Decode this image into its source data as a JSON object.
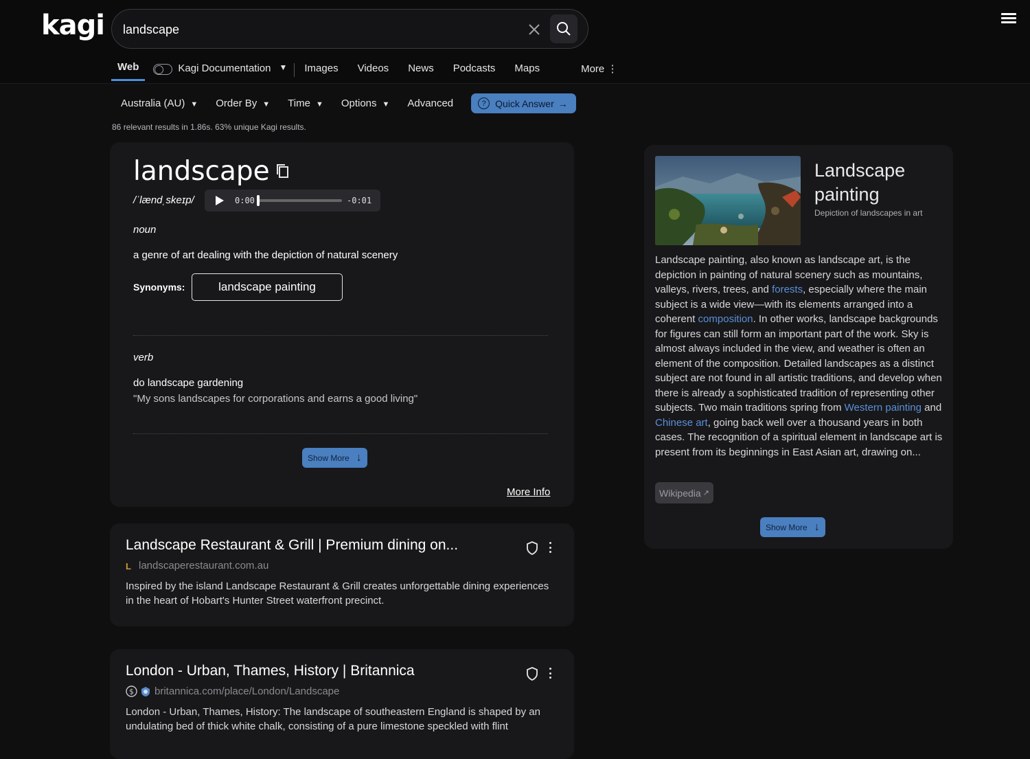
{
  "header": {
    "logo": "kagi",
    "search": {
      "value": "landscape",
      "placeholder": ""
    },
    "tabs": {
      "web": "Web",
      "lens": "Kagi Documentation",
      "images": "Images",
      "videos": "Videos",
      "news": "News",
      "podcasts": "Podcasts",
      "maps": "Maps",
      "more": "More"
    }
  },
  "filters": {
    "region": "Australia (AU)",
    "order_by": "Order By",
    "time": "Time",
    "options": "Options",
    "advanced": "Advanced",
    "quick_answer": "Quick Answer"
  },
  "stats": {
    "count": "86",
    "count_suffix": " relevant results in ",
    "time": "1.86s",
    "sep": ". ",
    "unique": "63%",
    "unique_suffix": " unique Kagi results."
  },
  "dictionary": {
    "word": "landscape",
    "phonetic": "/ˈlændˌskeɪp/",
    "audio": {
      "current": "0:00",
      "remaining": "-0:01",
      "progress": 0
    },
    "noun": {
      "pos": "noun",
      "definition": "a genre of art dealing with the depiction of natural scenery",
      "synonyms_label": "Synonyms:",
      "synonym": "landscape painting"
    },
    "verb": {
      "pos": "verb",
      "definition": "do landscape gardening",
      "example": "\"My sons landscapes for corporations and earns a good living\""
    },
    "show_more": "Show More",
    "more_info": "More Info"
  },
  "results": [
    {
      "title": "Landscape Restaurant & Grill | Premium dining on...",
      "favicon": "L",
      "url": "landscaperestaurant.com.au",
      "description": "Inspired by the island Landscape Restaurant & Grill creates unforgettable dining experiences in the heart of Hobart's Hunter Street waterfront precinct."
    },
    {
      "title": "London - Urban, Thames, History | Britannica",
      "favicon": "britannica-icon",
      "url": "britannica.com/place/London/Landscape",
      "description": "London - Urban, Thames, History: The landscape of southeastern England is shaped by an undulating bed of thick white chalk, consisting of a pure limestone speckled with flint"
    }
  ],
  "wiki": {
    "title": "Landscape painting",
    "subtitle": "Depiction of landscapes in art",
    "body": {
      "p1": "Landscape painting, also known as landscape art, is the depiction in painting of natural scenery such as mountains, valleys, rivers, trees, and ",
      "l1": "forests",
      "p2": ", especially where the main subject is a wide view—with its elements arranged into a coherent ",
      "l2": "composition",
      "p3": ". In other works, landscape backgrounds for figures can still form an important part of the work. Sky is almost always included in the view, and weather is often an element of the composition. Detailed landscapes as a distinct subject are not found in all artistic traditions, and develop when there is already a sophisticated tradition of representing other subjects. Two main traditions spring from ",
      "l3": "Western painting",
      "p4": " and ",
      "l4": "Chinese art",
      "p5": ", going back well over a thousand years in both cases. The recognition of a spiritual element in landscape art is present from its beginnings in East Asian art, drawing on..."
    },
    "source": "Wikipedia",
    "show_more": "Show More"
  },
  "colors": {
    "accent": "#4a7fc0",
    "link": "#5a8fd8",
    "background": "#0f0f10",
    "card": "#18181a"
  }
}
